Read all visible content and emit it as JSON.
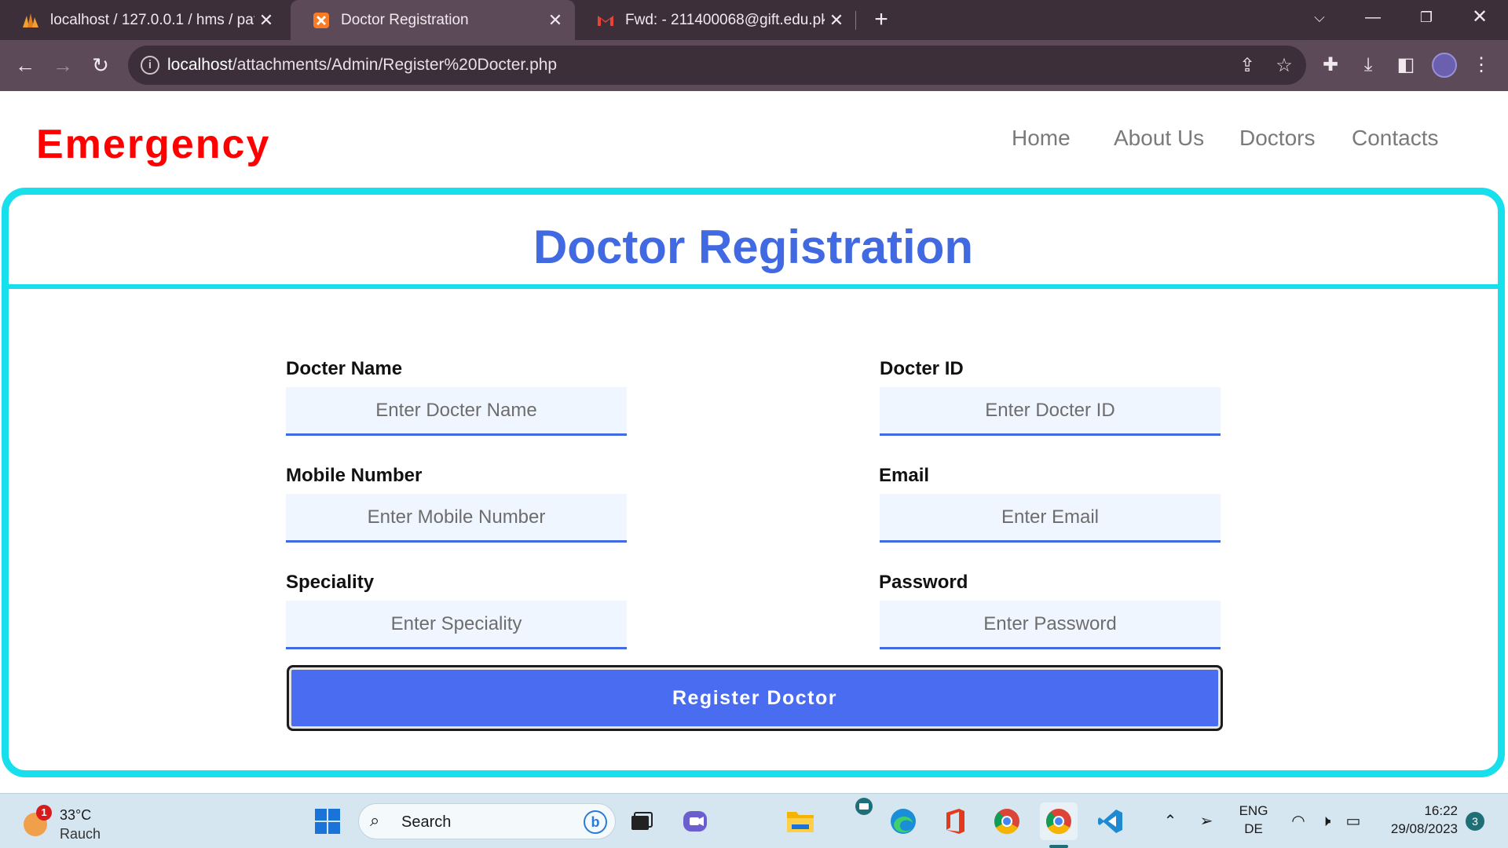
{
  "browser": {
    "tabs": [
      {
        "title": "localhost / 127.0.0.1 / hms / patie",
        "active": false,
        "icon": "phpmyadmin-icon"
      },
      {
        "title": "Doctor Registration",
        "active": true,
        "icon": "xampp-icon"
      },
      {
        "title": "Fwd: - 211400068@gift.edu.pk - ",
        "active": false,
        "icon": "gmail-icon"
      }
    ],
    "url_host": "localhost",
    "url_path": "/attachments/Admin/Register%20Docter.php"
  },
  "site": {
    "brand": "Emergency",
    "nav": [
      "Home",
      "About Us",
      "Doctors",
      "Contacts"
    ],
    "brand_color": "#ff0000"
  },
  "form": {
    "title": "Doctor Registration",
    "fields": {
      "name": {
        "label": "Docter Name",
        "placeholder": "Enter Docter Name"
      },
      "id": {
        "label": "Docter ID",
        "placeholder": "Enter Docter ID"
      },
      "mobile": {
        "label": "Mobile Number",
        "placeholder": "Enter Mobile Number"
      },
      "email": {
        "label": "Email",
        "placeholder": "Enter Email"
      },
      "speciality": {
        "label": "Speciality",
        "placeholder": "Enter Speciality"
      },
      "password": {
        "label": "Password",
        "placeholder": "Enter Password"
      }
    },
    "submit_label": "Register Doctor",
    "accent_color": "#4169e1",
    "border_color": "#17e0ec"
  },
  "taskbar": {
    "weather_badge": "1",
    "temperature": "33°C",
    "condition": "Rauch",
    "search_label": "Search",
    "lang_top": "ENG",
    "lang_bottom": "DE",
    "time": "16:22",
    "date": "29/08/2023",
    "notifications": "3"
  }
}
